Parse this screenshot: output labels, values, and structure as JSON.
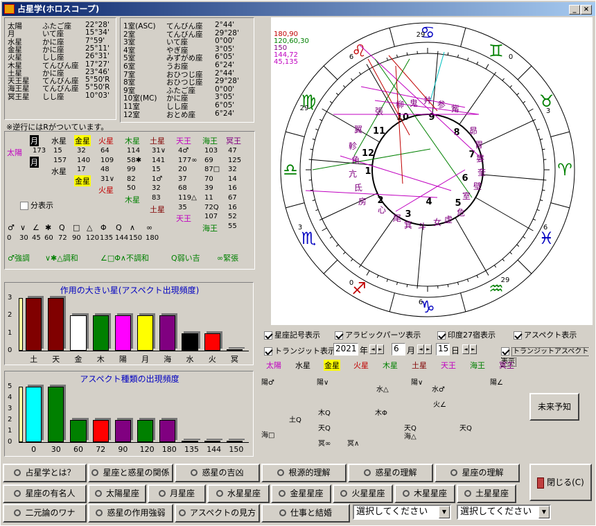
{
  "window": {
    "title": "占星学(ホロスコープ)",
    "controls": [
      "_",
      "□",
      "×"
    ]
  },
  "planets_list": {
    "rows": [
      [
        "太陽",
        "ふたご座",
        "22°28'"
      ],
      [
        "月",
        "いて座",
        "15°34'"
      ],
      [
        "水星",
        "かに座",
        "7°59'"
      ],
      [
        "金星",
        "かに座",
        "25°11'"
      ],
      [
        "火星",
        "しし座",
        "26°31'"
      ],
      [
        "木星",
        "てんびん座",
        "17°27'"
      ],
      [
        "土星",
        "かに座",
        "23°46'"
      ],
      [
        "天王星",
        "てんびん座",
        "5°50'R"
      ],
      [
        "海王星",
        "てんびん座",
        "5°50'R"
      ],
      [
        "冥王星",
        "しし座",
        "10°03'"
      ]
    ]
  },
  "houses_list": {
    "rows": [
      [
        "1室(ASC)",
        "てんびん座",
        "2°44'"
      ],
      [
        "2室",
        "てんびん座",
        "29°28'"
      ],
      [
        "3室",
        "いて座",
        "0°00'"
      ],
      [
        "4室",
        "やぎ座",
        "3°05'"
      ],
      [
        "5室",
        "みずがめ座",
        "6°05'"
      ],
      [
        "6室",
        "うお座",
        "6°24'"
      ],
      [
        "7室",
        "おひつじ座",
        "2°44'"
      ],
      [
        "8室",
        "おひつじ座",
        "29°28'"
      ],
      [
        "9室",
        "ふたご座",
        "0°00'"
      ],
      [
        "10室(MC)",
        "かに座",
        "3°05'"
      ],
      [
        "11室",
        "しし座",
        "6°05'"
      ],
      [
        "12室",
        "おとめ座",
        "6°24'"
      ]
    ]
  },
  "retro_note": "※逆行にはRがついています。",
  "aspect_table": {
    "header": [
      "月",
      "水星",
      "金星",
      "火星",
      "木星",
      "土星",
      "天王",
      "海王",
      "冥王"
    ],
    "rows": [
      {
        "label": "太陽",
        "cells": [
          "173",
          "15",
          "32",
          "64",
          "114",
          "31∨",
          "4♂",
          "103",
          "47"
        ]
      },
      {
        "label": "月",
        "cells": [
          "157",
          "140",
          "109",
          "58✱",
          "141",
          "177∞",
          "69",
          "125"
        ]
      },
      {
        "label": "水星",
        "cells": [
          "17",
          "48",
          "99",
          "15",
          "20",
          "87□",
          "32"
        ]
      },
      {
        "label": "金星",
        "cells": [
          "31∨",
          "82",
          "1♂",
          "37",
          "70",
          "14"
        ]
      },
      {
        "label": "火星",
        "cells": [
          "50",
          "32",
          "68",
          "39",
          "16"
        ]
      },
      {
        "label": "木星",
        "cells": [
          "83",
          "119△",
          "11",
          "67"
        ]
      },
      {
        "label": "土星",
        "cells": [
          "35",
          "72Q",
          "16"
        ]
      },
      {
        "label": "天王",
        "cells": [
          "107",
          "52"
        ]
      },
      {
        "label": "海王",
        "cells": [
          "55"
        ]
      }
    ],
    "split_label": "分表示",
    "symbols": [
      "♂",
      "∨",
      "∠",
      "✱",
      "Q",
      "□",
      "△",
      "Φ",
      "Q",
      "∧",
      "∞"
    ],
    "degrees": [
      "0",
      "30",
      "45",
      "60",
      "72",
      "90",
      "120",
      "135",
      "144",
      "150",
      "180"
    ],
    "legend": [
      "♂強調",
      "∨✱△調和",
      "∠□Φ∧不調和",
      "Q弱い吉",
      "∞緊張"
    ]
  },
  "chart1": {
    "title": "作用の大きい星(アスペクト出現頻度)",
    "type": "bar",
    "categories": [
      "土",
      "天",
      "金",
      "木",
      "陽",
      "月",
      "海",
      "水",
      "火",
      "冥"
    ],
    "values": [
      3,
      3,
      2,
      2,
      2,
      2,
      2,
      1,
      1,
      0
    ],
    "colors": [
      "#800000",
      "#800000",
      "#ffffff",
      "#008000",
      "#ff00ff",
      "#ffff00",
      "#800080",
      "#000000",
      "#ff0000",
      "#800000"
    ],
    "ylim": [
      0,
      3
    ],
    "yticks": [
      "0",
      "1",
      "2",
      "3"
    ]
  },
  "chart2": {
    "title": "アスペクト種類の出現頻度",
    "type": "bar",
    "categories": [
      "0",
      "30",
      "60",
      "72",
      "90",
      "120",
      "180",
      "135",
      "144",
      "150"
    ],
    "values": [
      5,
      5,
      2,
      2,
      2,
      2,
      2,
      0,
      0,
      0
    ],
    "colors": [
      "#00ffff",
      "#008000",
      "#008000",
      "#ff0000",
      "#800080",
      "#008000",
      "#800080",
      "#800080",
      "#c00000",
      "#0000c0"
    ],
    "ylim": [
      0,
      5
    ],
    "yticks": [
      "0",
      "1",
      "2",
      "3",
      "4",
      "5"
    ]
  },
  "chart_data": [
    {
      "type": "bar",
      "title": "作用の大きい星(アスペクト出現頻度)",
      "categories": [
        "土",
        "天",
        "金",
        "木",
        "陽",
        "月",
        "海",
        "水",
        "火",
        "冥"
      ],
      "values": [
        3,
        3,
        2,
        2,
        2,
        2,
        2,
        1,
        1,
        0
      ],
      "ylim": [
        0,
        3
      ]
    },
    {
      "type": "bar",
      "title": "アスペクト種類の出現頻度",
      "categories": [
        "0",
        "30",
        "60",
        "72",
        "90",
        "120",
        "180",
        "135",
        "144",
        "150"
      ],
      "values": [
        5,
        5,
        2,
        2,
        2,
        2,
        2,
        0,
        0,
        0
      ],
      "ylim": [
        0,
        5
      ]
    }
  ],
  "wheel": {
    "legend": [
      "180,90",
      "120,60,30",
      "150",
      "144,72",
      "45,135"
    ],
    "legend_colors": [
      "#c00000",
      "#008000",
      "#800080",
      "#c000c0",
      "#c000c0"
    ],
    "houses": [
      "1",
      "2",
      "3",
      "4",
      "5",
      "6",
      "7",
      "8",
      "9",
      "10",
      "11",
      "12"
    ],
    "mansions": [
      "張",
      "柳",
      "鬼",
      "井",
      "参",
      "觜",
      "翼",
      "昴",
      "軫",
      "胃",
      "角",
      "婁",
      "亢",
      "奎",
      "氐",
      "壁",
      "房",
      "心",
      "尾",
      "箕",
      "斗",
      "女",
      "虚",
      "危",
      "室"
    ],
    "degree_marks": [
      "29",
      "6",
      "29",
      "3",
      "0",
      "6",
      "29",
      "6",
      "3",
      "0"
    ]
  },
  "options": {
    "checks": [
      {
        "label": "星座記号表示",
        "on": true
      },
      {
        "label": "アラビックパーツ表示",
        "on": true
      },
      {
        "label": "印度27宿表示",
        "on": true
      },
      {
        "label": "アスペクト表示",
        "on": true
      }
    ],
    "transit_label": "トランジット表示",
    "transit_on": true,
    "year": "2021",
    "year_unit": "年",
    "month": "6",
    "month_unit": "月",
    "day": "15",
    "day_unit": "日",
    "transit_aspect_label": "トランジットアスペクト表示",
    "transit_aspect_on": true
  },
  "transit_tags": [
    "太陽",
    "水星",
    "金星",
    "火星",
    "木星",
    "土星",
    "天王",
    "海王",
    "冥王"
  ],
  "transit_aspects": [
    "陽♂",
    "陽∨",
    "水△",
    "陽∨",
    "水♂",
    "陽∠",
    "火∠",
    "木Q",
    "木Φ",
    "土Q",
    "天Q",
    "天Q",
    "天Q",
    "海□",
    "海△",
    "冥∞",
    "冥∧"
  ],
  "future_btn": "未来予知",
  "close_btn": "閉じる(C)",
  "buttons_row1": [
    "占星学とは？",
    "星座と惑星の関係",
    "惑星の吉凶",
    "根源的理解",
    "惑星の理解",
    "星座の理解"
  ],
  "buttons_row2": [
    "星座の有名人",
    "太陽星座",
    "月星座",
    "水星星座",
    "金星星座",
    "火星星座",
    "木星星座",
    "土星星座"
  ],
  "buttons_row3": [
    "二元論のワナ",
    "惑星の作用強弱",
    "アスペクトの見方",
    "仕事と結婚"
  ],
  "select1": "選択してください",
  "select2": "選択してください"
}
